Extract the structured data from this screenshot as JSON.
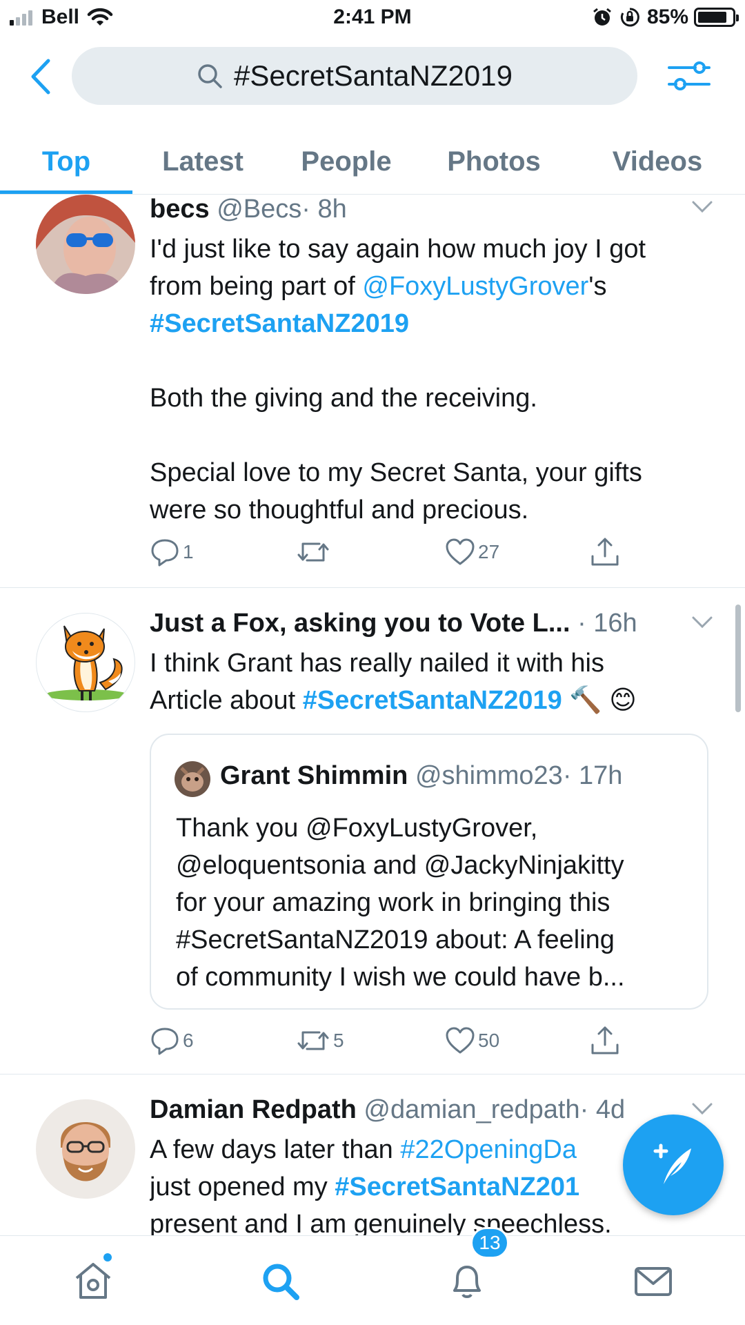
{
  "status_bar": {
    "carrier": "Bell",
    "time": "2:41 PM",
    "battery": "85%",
    "battery_level": 0.85,
    "icons": [
      "signal-icon",
      "wifi-icon",
      "alarm-icon",
      "orientation-lock-icon",
      "battery-icon"
    ]
  },
  "search": {
    "query": "#SecretSantaNZ2019"
  },
  "tabs": [
    "Top",
    "Latest",
    "People",
    "Photos",
    "Videos"
  ],
  "active_tab": "Top",
  "tweets": [
    {
      "name": "becs",
      "handle": "@Becs",
      "time": "· 8h",
      "body": {
        "l1": "I'd just like to say again how much joy I got",
        "l2_pre": "from being part of ",
        "l2_link": "@FoxyLustyGrover",
        "l2_post": "'s",
        "l3_tag": "#SecretSantaNZ2019",
        "p2": "Both the giving and the receiving.",
        "p3_l1": "Special love to my Secret Santa, your gifts",
        "p3_l2": "were so thoughtful and precious."
      },
      "replies": "1",
      "retweets": "",
      "likes": "27"
    },
    {
      "name": "Just a Fox, asking you to Vote L...",
      "handle": "",
      "time": "· 16h",
      "body": {
        "l1": "I think Grant has really nailed it with his",
        "l2_pre": "Article about ",
        "l2_tag": "#SecretSantaNZ2019",
        "l2_emoji": "🔨 😊"
      },
      "quote": {
        "name": "Grant Shimmin",
        "handle": "@shimmo23",
        "time": "· 17h",
        "lines": [
          "Thank you @FoxyLustyGrover,",
          "@eloquentsonia and @JackyNinjakitty",
          "for your amazing work in bringing this",
          "#SecretSantaNZ2019 about: A feeling",
          "of community I wish we could have b..."
        ]
      },
      "replies": "6",
      "retweets": "5",
      "likes": "50"
    },
    {
      "name": "Damian Redpath",
      "handle": "@damian_redpath",
      "time": "· 4d",
      "body": {
        "l1_pre": "A few days later than ",
        "l1_tag": "#22OpeningDa",
        "l2_pre": "just opened my ",
        "l2_tag": "#SecretSantaNZ201",
        "l3": "present and I am genuinely speechless."
      }
    }
  ],
  "bottom_nav": {
    "items": [
      "home-icon",
      "search-icon",
      "notifications-icon",
      "messages-icon"
    ],
    "notifications_badge": "13"
  },
  "colors": {
    "accent": "#1da1f2",
    "text": "#14171a",
    "secondary": "#657786",
    "divider": "#e1e8ed",
    "search_bg": "#e6ecf0"
  }
}
